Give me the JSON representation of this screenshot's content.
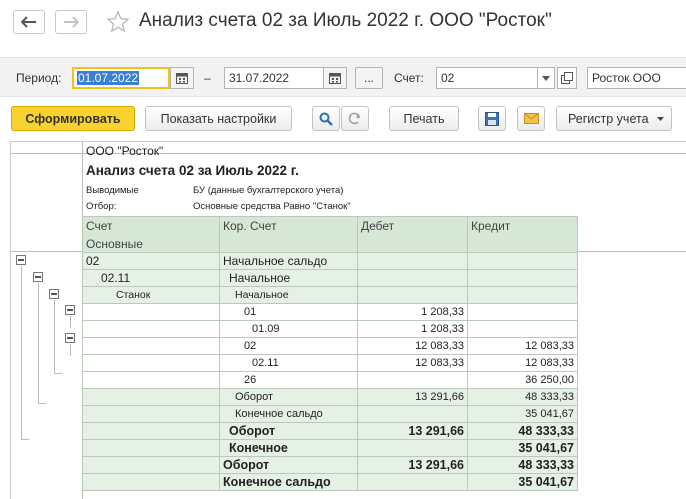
{
  "header": {
    "title": "Анализ счета 02 за Июль 2022 г. ООО \"Росток\""
  },
  "filter": {
    "period_label": "Период:",
    "date_from": "01.07.2022",
    "dash": "–",
    "date_to": "31.07.2022",
    "more_label": "...",
    "account_label": "Счет:",
    "account_value": "02",
    "org_value": "Росток ООО"
  },
  "toolbar": {
    "generate": "Сформировать",
    "settings": "Показать настройки",
    "print": "Печать",
    "register": "Регистр учета"
  },
  "report": {
    "org": "ООО \"Росток\"",
    "title": "Анализ счета 02 за Июль 2022 г.",
    "output_label": "Выводимые",
    "output_value": "БУ (данные бухгалтерского учета)",
    "filter_label": "Отбор:",
    "filter_value": "Основные средства Равно \"Станок\"",
    "columns": {
      "account": "Счет",
      "account_sub": "Основные",
      "corr": "Кор. Счет",
      "debit": "Дебет",
      "credit": "Кредит"
    },
    "rows": [
      {
        "account": "02",
        "corr": "Начальное сальдо",
        "debit": "",
        "credit": ""
      },
      {
        "account": "02.11",
        "corr": "Начальное",
        "debit": "",
        "credit": ""
      },
      {
        "account": "Станок",
        "corr": "Начальное",
        "debit": "",
        "credit": ""
      },
      {
        "account": "",
        "corr": "01",
        "debit": "1 208,33",
        "credit": ""
      },
      {
        "account": "",
        "corr": "01.09",
        "debit": "1 208,33",
        "credit": ""
      },
      {
        "account": "",
        "corr": "02",
        "debit": "12 083,33",
        "credit": "12 083,33"
      },
      {
        "account": "",
        "corr": "02.11",
        "debit": "12 083,33",
        "credit": "12 083,33"
      },
      {
        "account": "",
        "corr": "26",
        "debit": "",
        "credit": "36 250,00"
      },
      {
        "account": "",
        "corr": "Оборот",
        "debit": "13 291,66",
        "credit": "48 333,33"
      },
      {
        "account": "",
        "corr": "Конечное сальдо",
        "debit": "",
        "credit": "35 041,67"
      },
      {
        "account": "",
        "corr": "Оборот",
        "debit": "13 291,66",
        "credit": "48 333,33"
      },
      {
        "account": "",
        "corr": "Конечное",
        "debit": "",
        "credit": "35 041,67"
      },
      {
        "account": "",
        "corr": "Оборот",
        "debit": "13 291,66",
        "credit": "48 333,33"
      },
      {
        "account": "",
        "corr": "Конечное сальдо",
        "debit": "",
        "credit": "35 041,67"
      }
    ]
  }
}
